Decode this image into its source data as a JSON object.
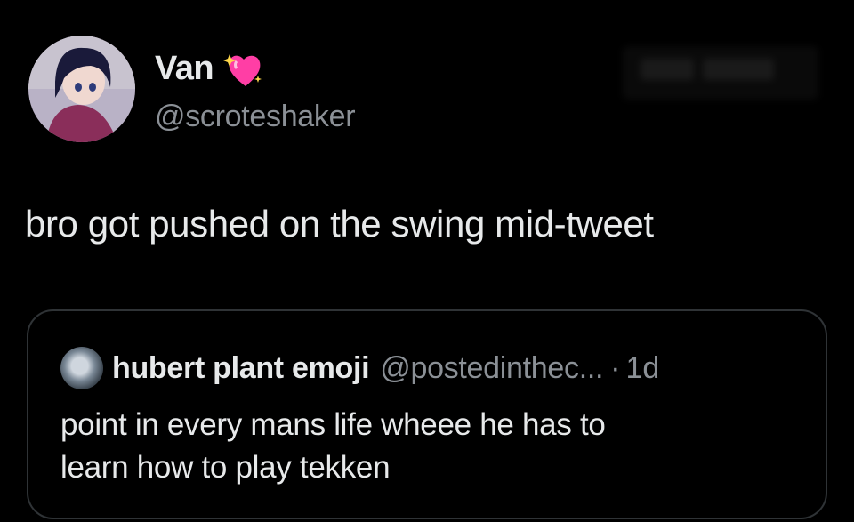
{
  "tweet": {
    "author": {
      "display_name": "Van",
      "handle": "@scroteshaker",
      "badge_icon": "sparkling-heart-icon"
    },
    "text": "bro got pushed on the swing mid-tweet"
  },
  "quoted_tweet": {
    "author": {
      "display_name": "hubert plant emoji",
      "handle": "@postedinthec...",
      "separator": "·",
      "time": "1d"
    },
    "text_line1": "point in every mans life wheee he has to",
    "text_line2": "learn how to play tekken"
  },
  "colors": {
    "background": "#000000",
    "primary_text": "#e7e9ea",
    "secondary_text": "#8b9096",
    "border": "#2f3336",
    "heart": "#ff3ea5"
  }
}
